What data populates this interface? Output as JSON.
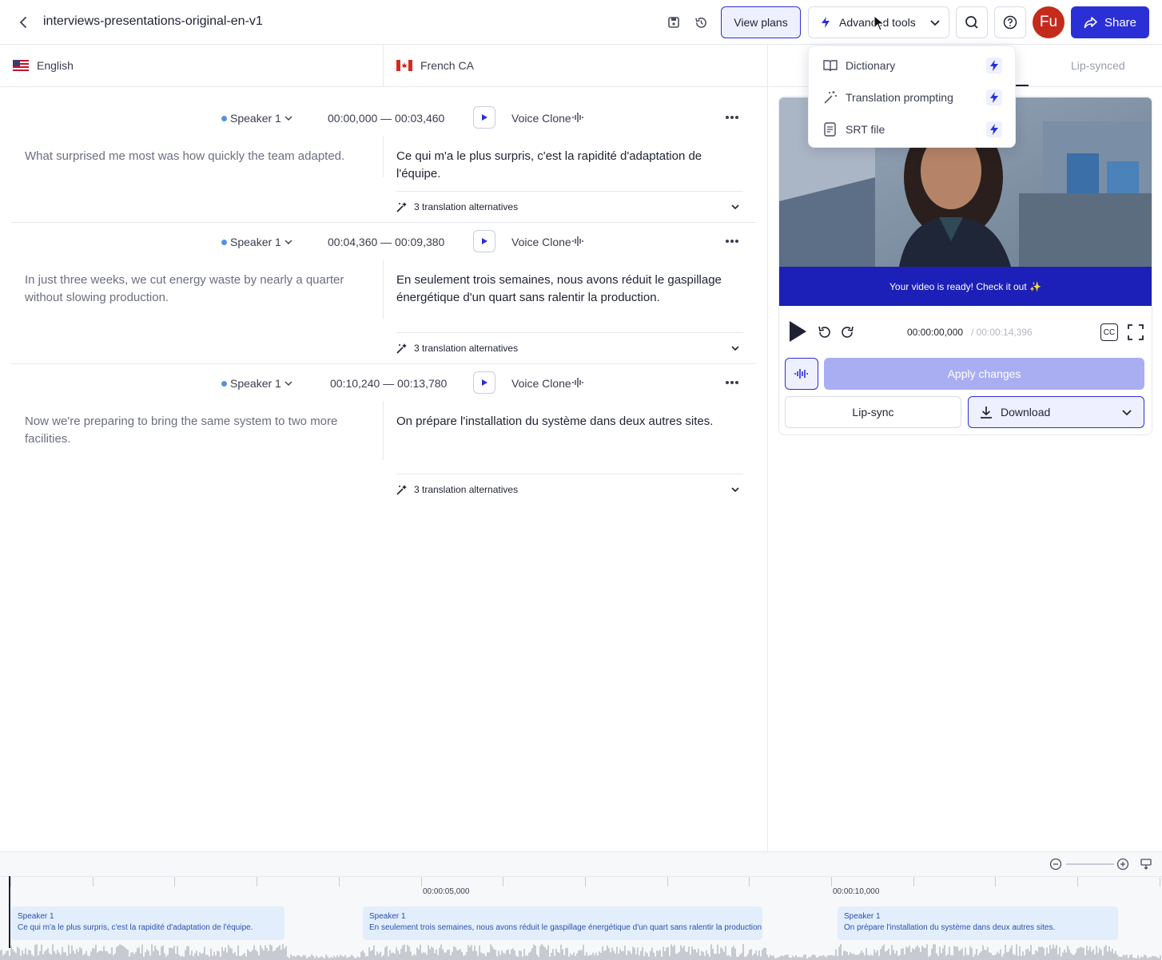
{
  "header": {
    "title": "interviews-presentations-original-en-v1",
    "view_plans": "View plans",
    "advanced_tools": "Advanced tools",
    "avatar_initials": "Fu",
    "share": "Share",
    "accent": "#2b2fd6",
    "avatar_color": "#c42b1c"
  },
  "languages": {
    "source": "English",
    "target": "French CA"
  },
  "segments": [
    {
      "speaker": "Speaker 1",
      "time": "00:00,000 — 00:03,460",
      "voice": "Voice Clone",
      "source": "What surprised me most was how quickly the team adapted.",
      "target": "Ce qui m'a le plus surpris, c'est la rapidité d'adaptation de l'équipe.",
      "alternatives": "3 translation alternatives"
    },
    {
      "speaker": "Speaker 1",
      "time": "00:04,360 — 00:09,380",
      "voice": "Voice Clone",
      "source": "In just three weeks, we cut energy waste by nearly a quarter without slowing production.",
      "target": "En seulement trois semaines, nous avons réduit le gaspillage énergétique d'un quart sans ralentir la production.",
      "alternatives": "3 translation alternatives"
    },
    {
      "speaker": "Speaker 1",
      "time": "00:10,240 — 00:13,780",
      "voice": "Voice Clone",
      "source": "Now we're preparing to bring the same system to two more facilities.",
      "target": "On prépare l'installation du système dans deux autres sites.",
      "alternatives": "3 translation alternatives"
    }
  ],
  "dropdown": {
    "items": [
      {
        "label": "Dictionary",
        "icon": "book-icon"
      },
      {
        "label": "Translation prompting",
        "icon": "magic-wand-icon"
      },
      {
        "label": "SRT file",
        "icon": "file-icon"
      }
    ]
  },
  "right_panel": {
    "tab_lipsynced": "Lip-synced",
    "banner": "Your video is ready! Check it out ✨",
    "current_time": "00:00:00,000",
    "total_time": "/ 00:00:14,396",
    "cc": "CC",
    "apply_changes": "Apply changes",
    "lipsync": "Lip-sync",
    "download": "Download"
  },
  "timeline": {
    "ticks": [
      "00:00:05,000",
      "00:00:10,000"
    ],
    "clips": [
      {
        "speaker": "Speaker 1",
        "text": "Ce qui m'a le plus surpris, c'est la rapidité d'adaptation de l'équipe."
      },
      {
        "speaker": "Speaker 1",
        "text": "En seulement trois semaines, nous avons réduit le gaspillage énergétique d'un quart sans ralentir la production."
      },
      {
        "speaker": "Speaker 1",
        "text": "On prépare l'installation du système dans deux autres sites."
      }
    ]
  }
}
